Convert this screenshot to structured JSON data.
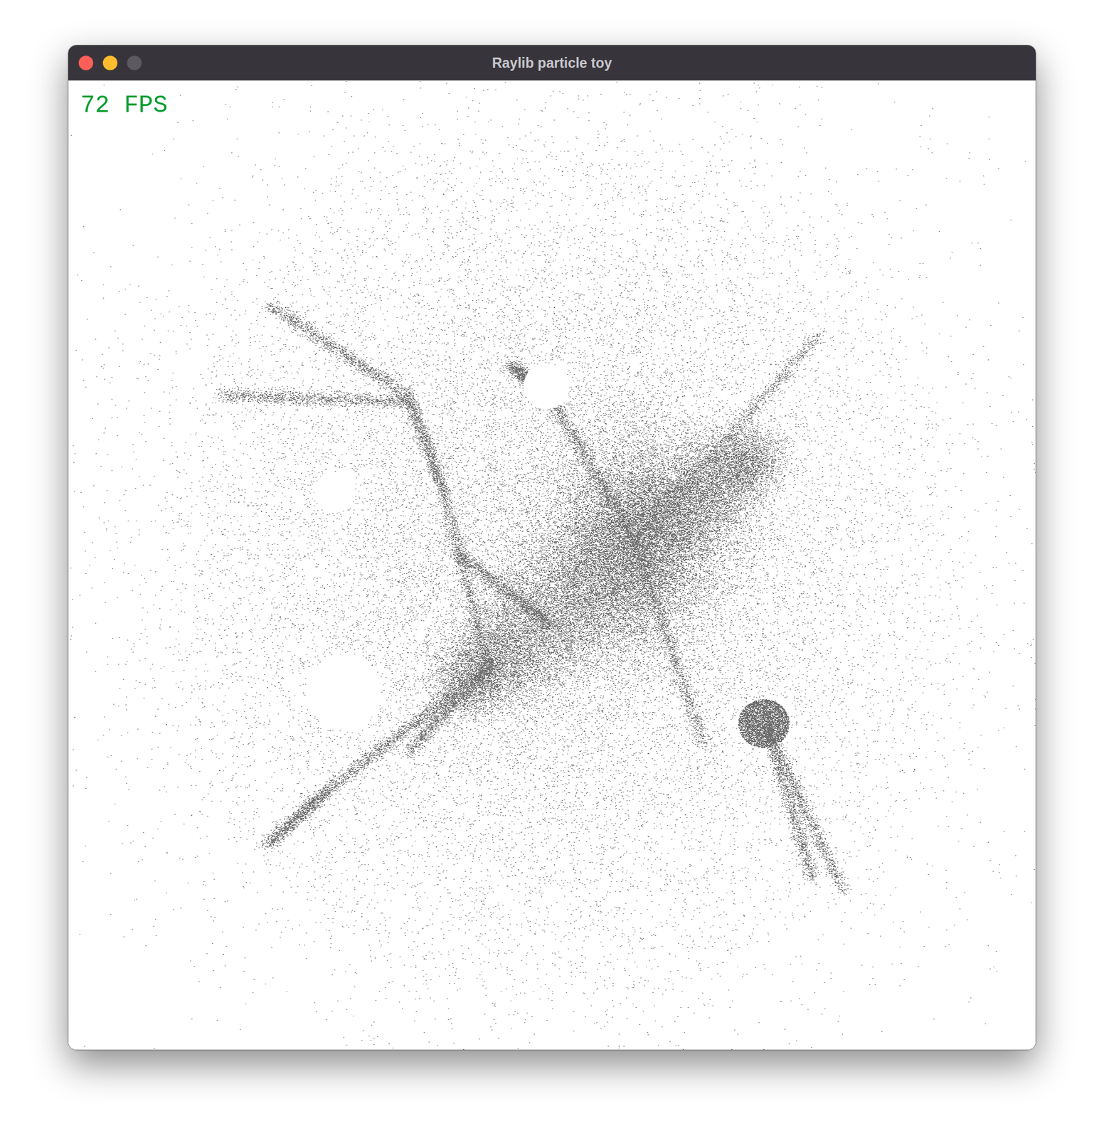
{
  "window": {
    "title": "Raylib particle toy",
    "controls": [
      {
        "name": "close",
        "color": "#ff5f57"
      },
      {
        "name": "minimize",
        "color": "#febc2e"
      },
      {
        "name": "zoom",
        "color": "#5c5a60"
      }
    ]
  },
  "fps_counter": {
    "text": "72 FPS",
    "color": "#009e2f"
  }
}
